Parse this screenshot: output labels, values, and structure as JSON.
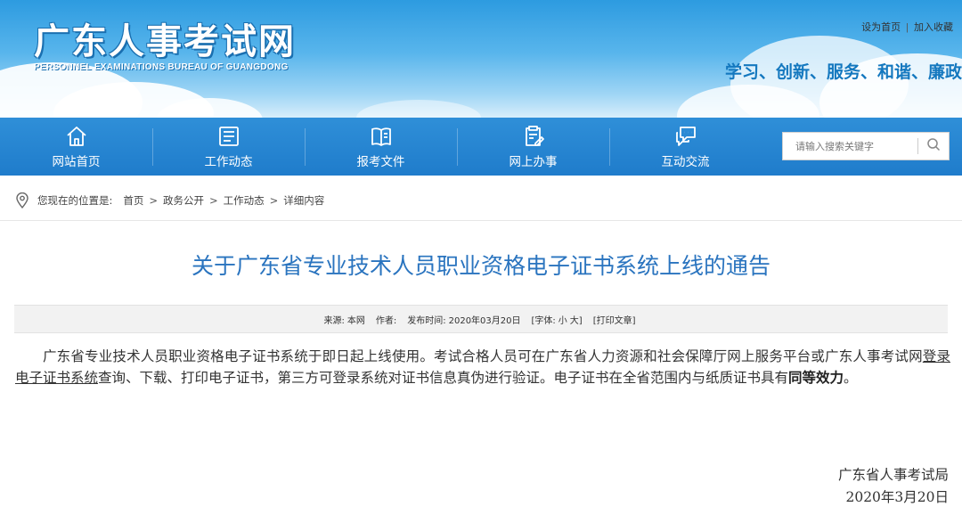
{
  "header": {
    "title": "广东人事考试网",
    "subtitle": "PERSONNEL EXAMINATIONS BUREAU OF GUANGDONG",
    "links": [
      "设为首页",
      "加入收藏"
    ],
    "link_separator": "|",
    "slogan": "学习、创新、服务、和谐、廉政"
  },
  "nav": {
    "items": [
      {
        "label": "网站首页",
        "icon": "home-icon"
      },
      {
        "label": "工作动态",
        "icon": "news-list-icon"
      },
      {
        "label": "报考文件",
        "icon": "book-icon"
      },
      {
        "label": "网上办事",
        "icon": "clipboard-edit-icon"
      },
      {
        "label": "互动交流",
        "icon": "chat-bubbles-icon"
      }
    ],
    "search": {
      "placeholder": "请输入搜索关键字",
      "icon": "search-icon"
    }
  },
  "breadcrumb": {
    "prefix": "您现在的位置是:",
    "items": [
      "首页",
      "政务公开",
      "工作动态",
      "详细内容"
    ],
    "separator": ">"
  },
  "article": {
    "title": "关于广东省专业技术人员职业资格电子证书系统上线的通告",
    "meta": {
      "source_label": "来源:",
      "source_value": "本网",
      "author_label": "作者:",
      "date_label": "发布时间:",
      "date_value": "2020年03月20日",
      "font_label": "[字体:",
      "font_small": "小",
      "font_large": "大]",
      "print_label": "[打印文章]"
    },
    "body": {
      "part1": "广东省专业技术人员职业资格电子证书系统于即日起上线使用。考试合格人员可在广东省人力资源和社会保障厅网上服务平台或广东人事考试网",
      "link": "登录电子证书系统",
      "part2": "查询、下载、打印电子证书，第三方可登录系统对证书信息真伪进行验证。电子证书在全省范围内与纸质证书具有",
      "bold": "同等效力",
      "part3": "。"
    },
    "signature_org": "广东省人事考试局",
    "signature_date": "2020年3月20日"
  },
  "colors": {
    "nav_bg": "#1f7ccb",
    "title_blue": "#2a74bf",
    "slogan_blue": "#1478bf"
  }
}
